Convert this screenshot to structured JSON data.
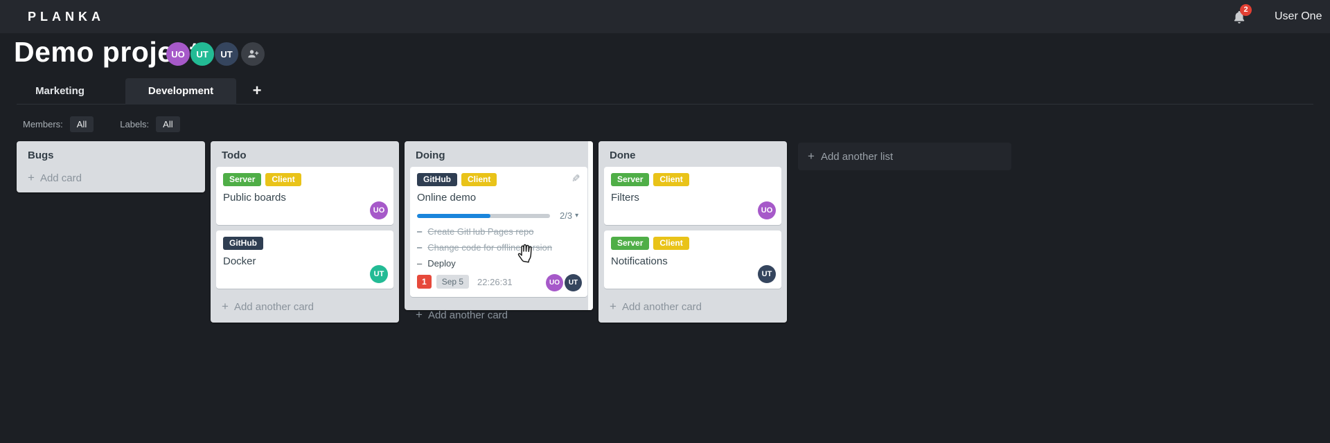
{
  "icons": {
    "plus": "+",
    "caret_down": "▾",
    "dash": "–",
    "pencil": "✎"
  },
  "topbar": {
    "logo": "PLANKA",
    "user_name": "User One",
    "notification_count": "2"
  },
  "project": {
    "title": "Demo project",
    "members": [
      {
        "initials": "UO",
        "color": "#a659c9"
      },
      {
        "initials": "UT",
        "color": "#23bb95"
      },
      {
        "initials": "UT",
        "color": "#35455e"
      }
    ]
  },
  "tabs": {
    "items": [
      {
        "label": "Marketing"
      },
      {
        "label": "Development"
      }
    ],
    "add_button": "+"
  },
  "filters": {
    "members_label": "Members:",
    "members_value": "All",
    "labels_label": "Labels:",
    "labels_value": "All"
  },
  "board": {
    "add_list_label": "Add another list",
    "lists": [
      {
        "name": "Bugs",
        "add_card_label": "Add card",
        "cards": []
      },
      {
        "name": "Todo",
        "add_card_label": "Add another card",
        "cards": [
          {
            "title": "Public boards",
            "labels": [
              {
                "text": "Server",
                "color": "#4fae47"
              },
              {
                "text": "Client",
                "color": "#e9c319"
              }
            ],
            "members": [
              {
                "initials": "UO",
                "color": "#a659c9"
              }
            ]
          },
          {
            "title": "Docker",
            "labels": [
              {
                "text": "GitHub",
                "color": "#2f3e52"
              }
            ],
            "members": [
              {
                "initials": "UT",
                "color": "#23bb95"
              }
            ]
          }
        ]
      },
      {
        "name": "Doing",
        "add_card_label": "Add another card",
        "cards": [
          {
            "title": "Online demo",
            "labels": [
              {
                "text": "GitHub",
                "color": "#2f3e52"
              },
              {
                "text": "Client",
                "color": "#e9c319"
              }
            ],
            "progress": {
              "text": "2/3",
              "percent": 55,
              "fill_style": "width:55%"
            },
            "tasks": [
              {
                "text": "Create GitHub Pages repo",
                "completed": true
              },
              {
                "text": "Change code for offline version",
                "completed": true
              },
              {
                "text": "Deploy",
                "completed": false
              }
            ],
            "due_count": "1",
            "due_date": "Sep 5",
            "timer": "22:26:31",
            "members": [
              {
                "initials": "UO",
                "color": "#a659c9"
              },
              {
                "initials": "UT",
                "color": "#35455e"
              }
            ]
          }
        ]
      },
      {
        "name": "Done",
        "add_card_label": "Add another card",
        "cards": [
          {
            "title": "Filters",
            "labels": [
              {
                "text": "Server",
                "color": "#4fae47"
              },
              {
                "text": "Client",
                "color": "#e9c319"
              }
            ],
            "members": [
              {
                "initials": "UO",
                "color": "#a659c9"
              }
            ]
          },
          {
            "title": "Notifications",
            "labels": [
              {
                "text": "Server",
                "color": "#4fae47"
              },
              {
                "text": "Client",
                "color": "#e9c319"
              }
            ],
            "members": [
              {
                "initials": "UT",
                "color": "#35455e"
              }
            ]
          }
        ]
      }
    ]
  }
}
